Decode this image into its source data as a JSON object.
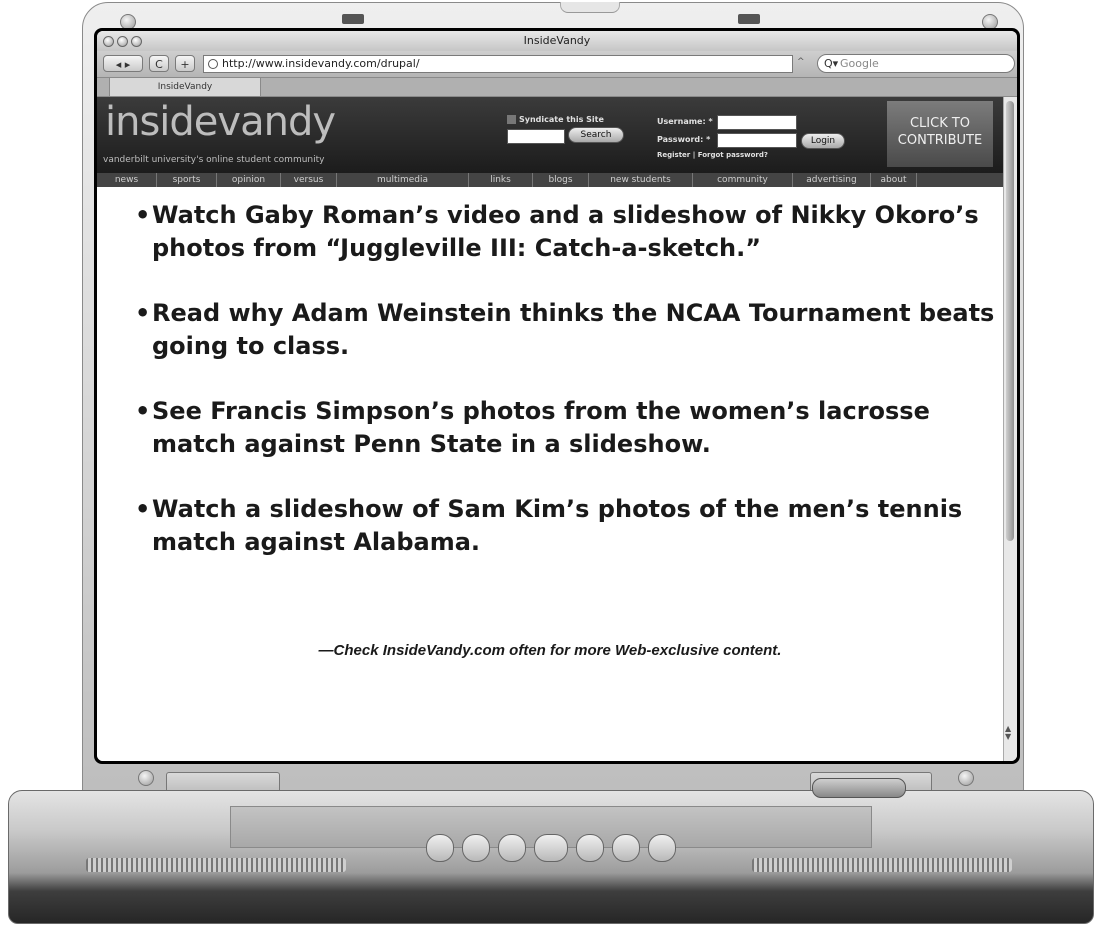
{
  "browser": {
    "window_title": "InsideVandy",
    "url": "http://www.insidevandy.com/drupal/",
    "search_placeholder": "Google",
    "tab_label": "InsideVandy",
    "nav_buttons": {
      "back_forward": "◂ ▸",
      "reload": "C",
      "add": "+"
    }
  },
  "site": {
    "logo": "insidevandy",
    "tagline": "vanderbilt university's online student community",
    "syndicate_label": "Syndicate this Site",
    "search_button": "Search",
    "username_label": "Username: *",
    "password_label": "Password: *",
    "login_button": "Login",
    "register_link": "Register",
    "forgot_link": "Forgot password?",
    "contribute_line1": "CLICK TO",
    "contribute_line2": "CONTRIBUTE",
    "nav": [
      "news",
      "sports",
      "opinion",
      "versus",
      "multimedia",
      "links",
      "blogs",
      "new students",
      "community",
      "advertising",
      "about"
    ]
  },
  "article": {
    "items": [
      "Watch Gaby Roman’s video and a slideshow of Nikky Okoro’s photos from “Juggleville III: Catch-a-sketch.”",
      "Read why Adam Weinstein thinks the NCAA Tournament beats going to class.",
      "See Francis Simpson’s photos from the women’s lacrosse match against Penn State in a slideshow.",
      "Watch a slideshow of Sam Kim’s photos of the men’s tennis match against Alabama."
    ],
    "note": "—Check InsideVandy.com often for more Web-exclusive content."
  }
}
